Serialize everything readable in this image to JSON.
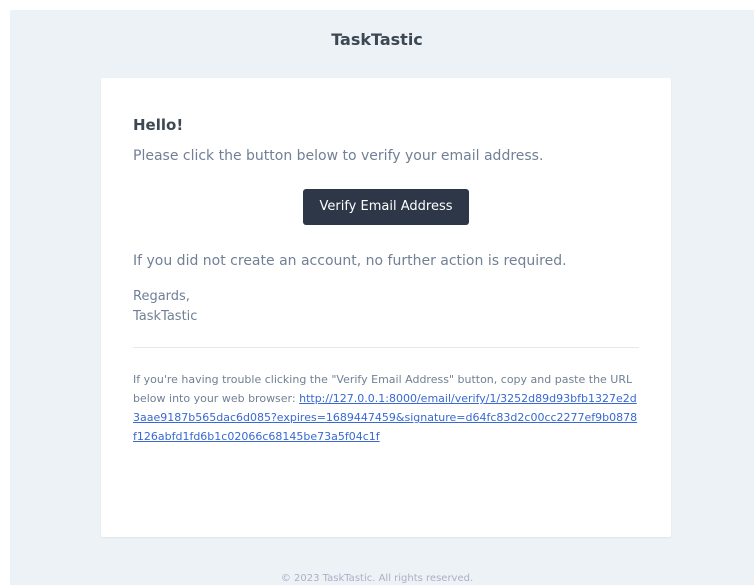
{
  "header": {
    "brand": "TaskTastic"
  },
  "email": {
    "greeting": "Hello!",
    "intro": "Please click the button below to verify your email address.",
    "button_label": "Verify Email Address",
    "outro": "If you did not create an account, no further action is required.",
    "regards": "Regards,",
    "signature": "TaskTastic",
    "subcopy_text": "If you're having trouble clicking the \"Verify Email Address\" button, copy and paste the URL below into your web browser: ",
    "verify_url": "http://127.0.0.1:8000/email/verify/1/3252d89d93bfb1327e2d3aae9187b565dac6d085?expires=1689447459&signature=d64fc83d2c00cc2277ef9b0878f126abfd1fd6b1c02066c68145be73a5f04c1f"
  },
  "footer": {
    "copyright": "© 2023 TaskTastic. All rights reserved."
  },
  "colors": {
    "background": "#edf2f7",
    "card": "#ffffff",
    "button": "#2d3748",
    "text": "#718096",
    "heading": "#3d4852",
    "link": "#3869d4"
  }
}
